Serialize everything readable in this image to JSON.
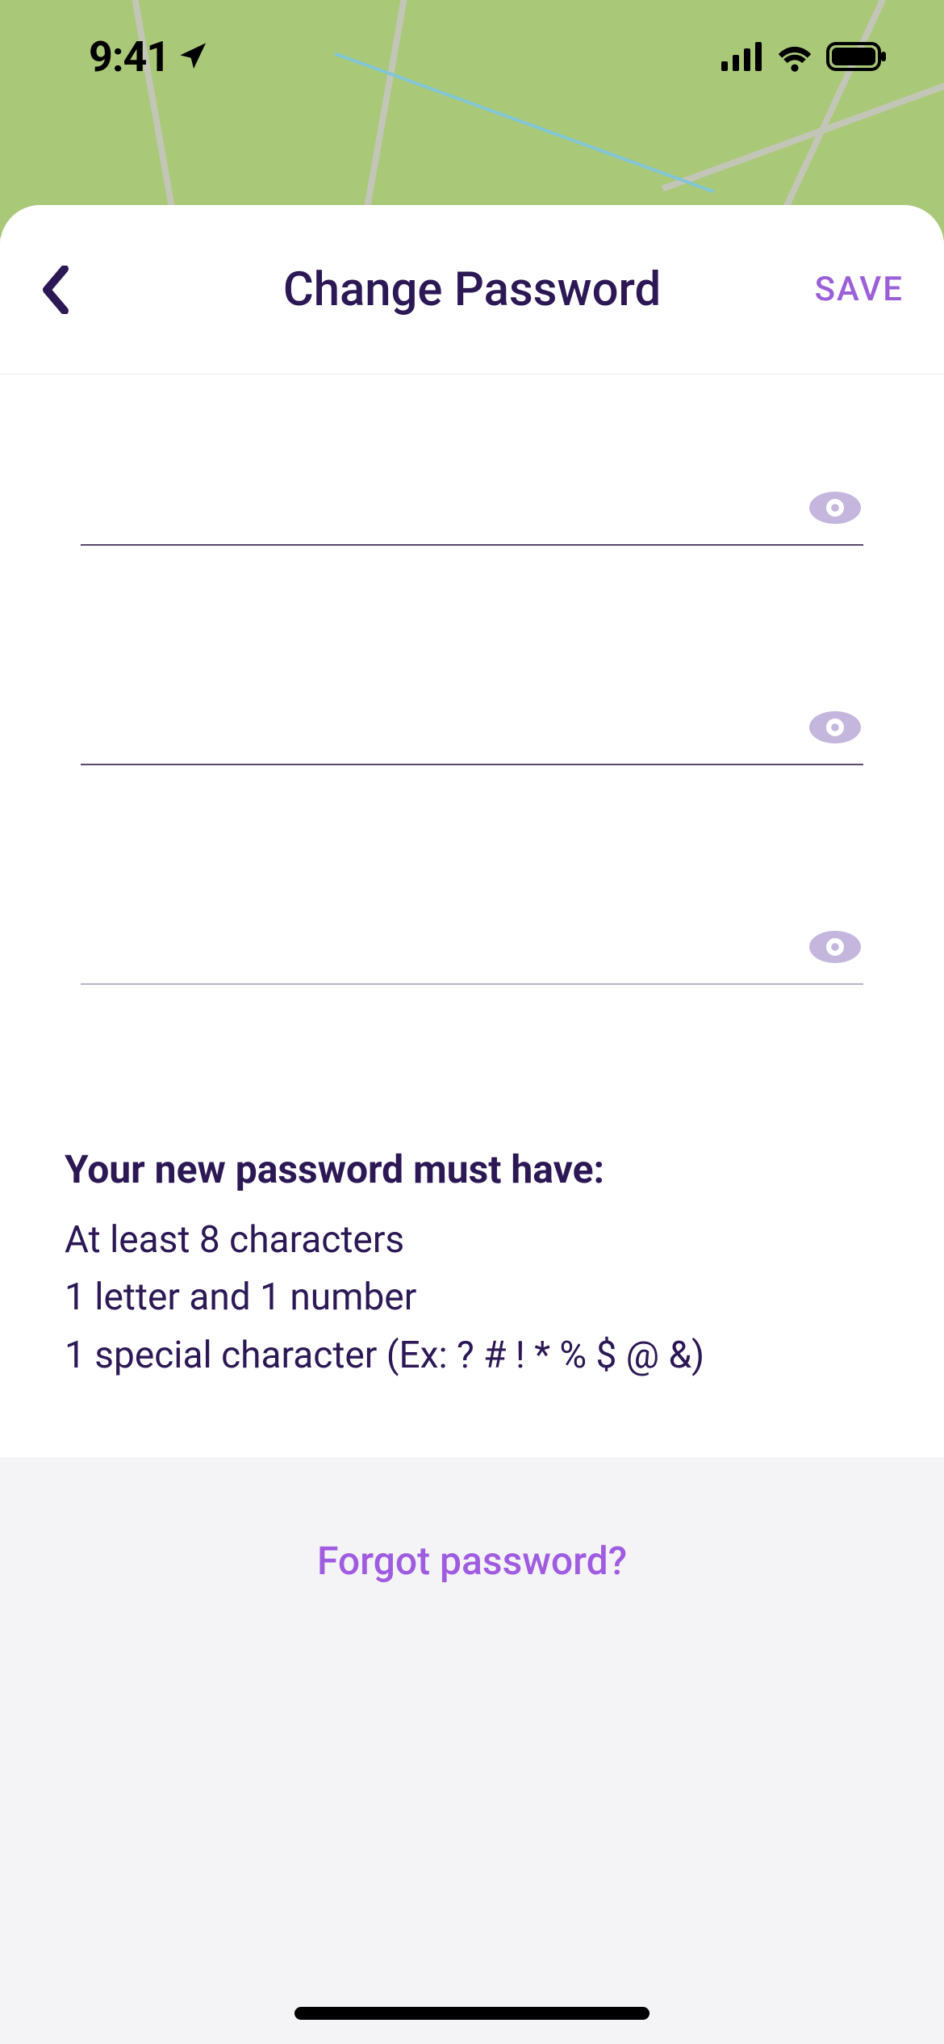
{
  "status_bar": {
    "time": "9:41"
  },
  "header": {
    "title": "Change Password",
    "save_label": "SAVE"
  },
  "fields": {
    "current_password": {
      "value": ""
    },
    "new_password": {
      "value": ""
    },
    "confirm_password": {
      "value": ""
    }
  },
  "requirements": {
    "title": "Your new password must have:",
    "items": [
      "At least 8 characters",
      "1 letter and 1 number",
      "1 special character (Ex: ? # ! * % $ @ &)"
    ]
  },
  "forgot_link": "Forgot password?",
  "colors": {
    "accent_purple": "#9b5fd9",
    "text_dark": "#2c1854",
    "map_green": "#a9c878",
    "eye_fill": "#c4b6dc"
  }
}
